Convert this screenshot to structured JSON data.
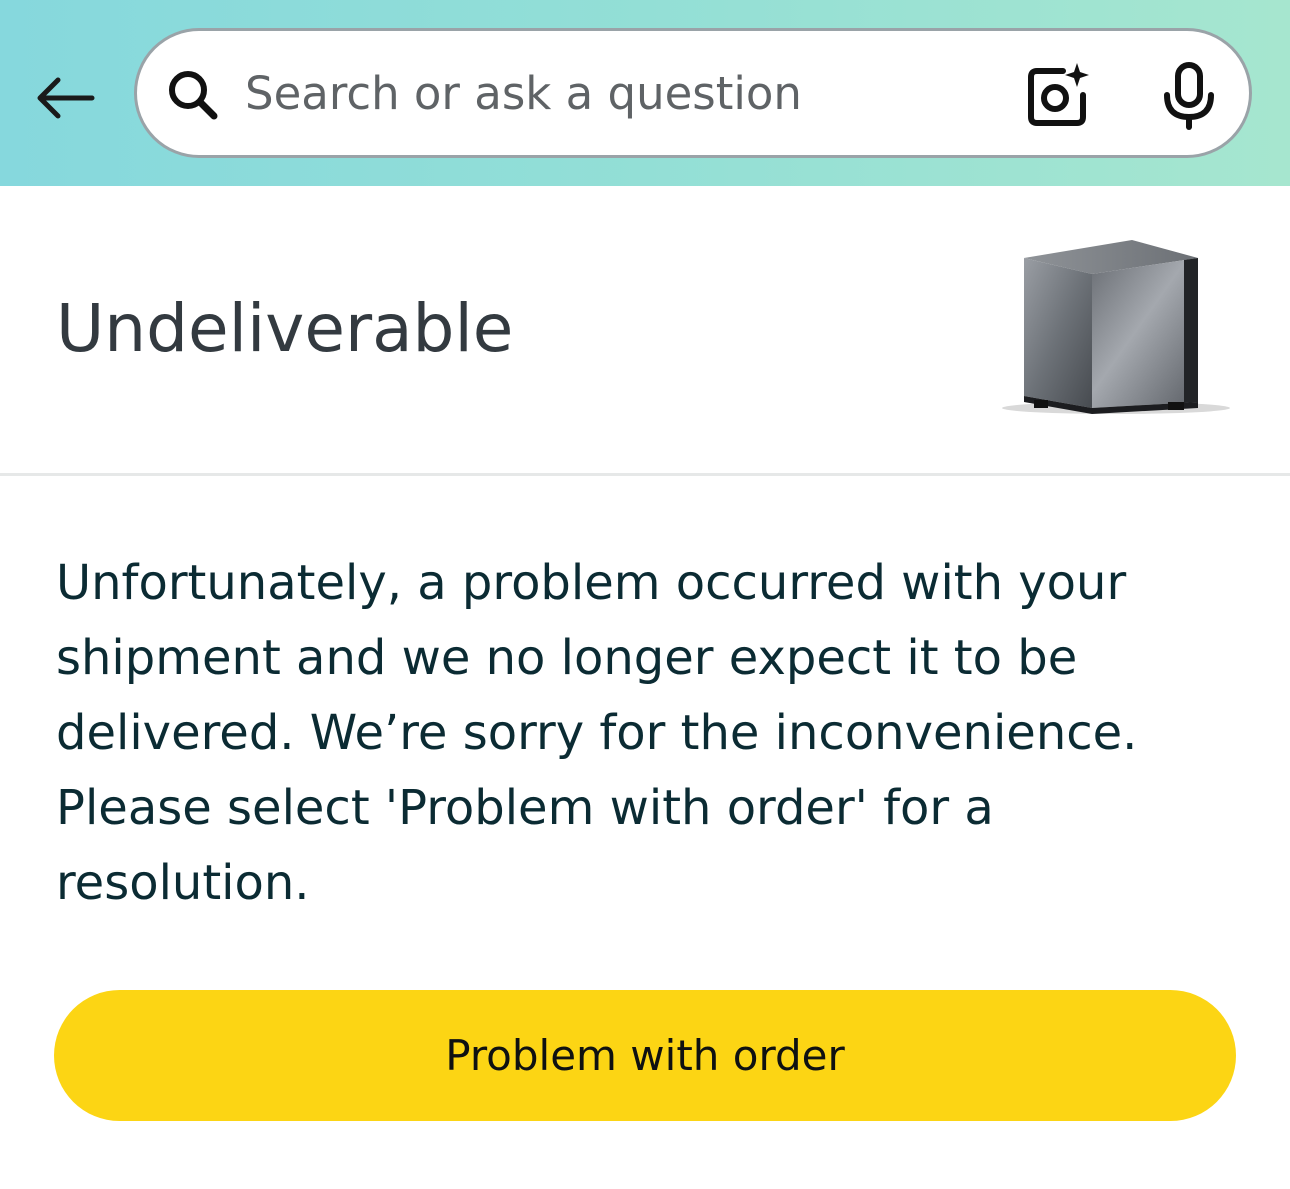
{
  "header": {
    "back_icon": "arrow-left-icon",
    "search": {
      "placeholder": "Search or ask a question",
      "value": "",
      "search_icon": "magnifier-icon",
      "camera_icon": "camera-sparkle-icon",
      "mic_icon": "microphone-icon"
    },
    "gradient_colors": [
      "#86d8dd",
      "#a6e6cf"
    ]
  },
  "status": {
    "title": "Undeliverable",
    "product_image": "pc-case-product-image"
  },
  "message": {
    "text": "Unfortunately, a problem occurred with your shipment and we no longer expect it to be delivered. We’re sorry for the inconvenience. Please select 'Problem with order' for a resolution."
  },
  "actions": {
    "problem_label": "Problem with order",
    "button_color": "#fcd514"
  }
}
